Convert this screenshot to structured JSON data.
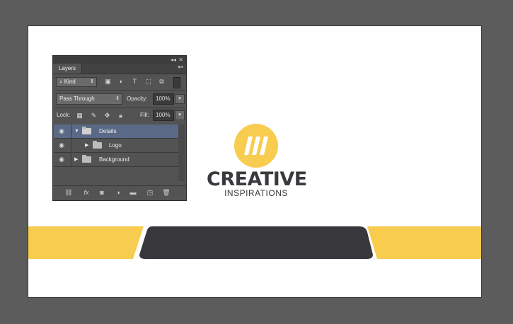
{
  "panel": {
    "tab_label": "Layers",
    "collapse_glyph": "◂◂",
    "close_glyph": "✕",
    "menu_glyph": "▾≡",
    "filter": {
      "value": "Kind",
      "icon": "search-icon"
    },
    "blend_mode": "Pass Through",
    "opacity_label": "Opacity:",
    "opacity_value": "100%",
    "lock_label": "Lock:",
    "fill_label": "Fill:",
    "fill_value": "100%",
    "layers": [
      {
        "name": "Details",
        "type": "group",
        "expanded": true,
        "selected": true
      },
      {
        "name": "Logo",
        "type": "group",
        "expanded": false,
        "selected": false
      },
      {
        "name": "Background",
        "type": "group",
        "expanded": false,
        "selected": false
      }
    ],
    "footer_icons": [
      "link-icon",
      "fx-icon",
      "mask-icon",
      "adjustment-icon",
      "new-group-icon",
      "new-layer-icon",
      "trash-icon"
    ]
  },
  "design": {
    "brand_title": "CREATIVE",
    "brand_subtitle": "INSPIRATIONS",
    "accent_color": "#f8cc4f",
    "dark_color": "#38373b"
  }
}
